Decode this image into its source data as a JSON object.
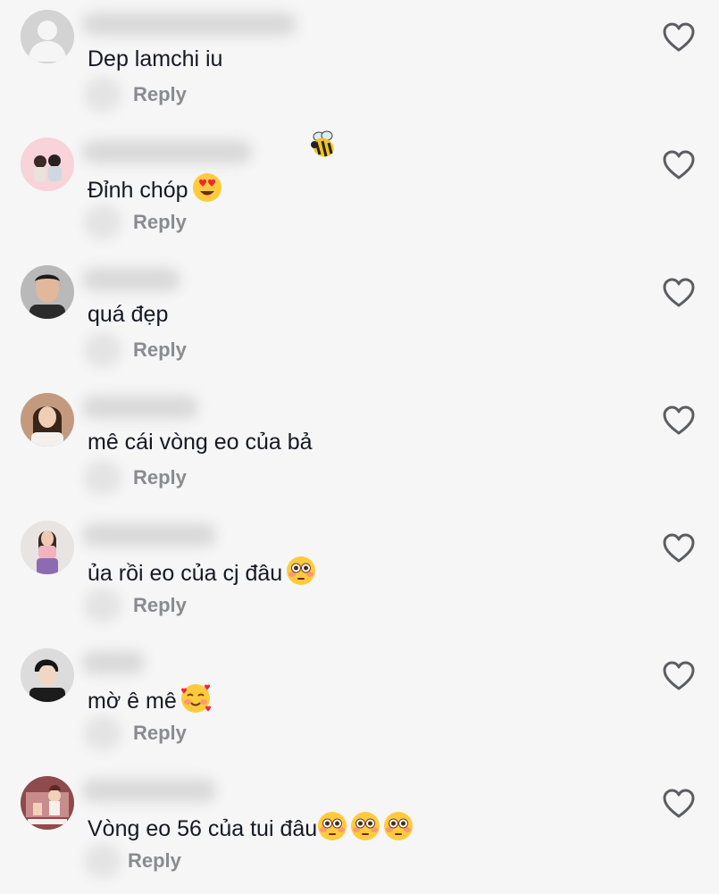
{
  "comments": [
    {
      "text": "Dep lamchi iu",
      "emoji": [],
      "reply_label": "Reply",
      "avatar": "default-avatar",
      "username_width": 240
    },
    {
      "text": "Đỉnh chóp",
      "emoji": [
        "heart-eyes-emoji"
      ],
      "reply_label": "Reply",
      "avatar": "couple-photo-avatar",
      "username_width": 190,
      "username_emoji": "bee-emoji"
    },
    {
      "text": "quá đẹp",
      "emoji": [],
      "reply_label": "Reply",
      "avatar": "man-photo-avatar",
      "username_width": 110
    },
    {
      "text": "mê cái vòng eo của bả",
      "emoji": [],
      "reply_label": "Reply",
      "avatar": "woman-photo-avatar",
      "username_width": 130
    },
    {
      "text": "ủa rồi eo của cj đâu",
      "emoji": [
        "flushed-emoji"
      ],
      "reply_label": "Reply",
      "avatar": "woman-pink-avatar",
      "username_width": 150
    },
    {
      "text": "mờ ê mê",
      "emoji": [
        "smiling-hearts-emoji"
      ],
      "reply_label": "Reply",
      "avatar": "man-dark-avatar",
      "username_width": 70
    },
    {
      "text": "Vòng eo 56 của tui đâu",
      "emoji": [
        "flushed-emoji",
        "flushed-emoji",
        "flushed-emoji"
      ],
      "reply_label": "Reply",
      "avatar": "cartoon-avatar",
      "username_width": 150
    }
  ],
  "colors": {
    "background": "#f6f6f6",
    "text": "#161823",
    "reply": "#8a8b91",
    "icon": "#5c5d63"
  },
  "icons": {
    "like": "heart-outline-icon"
  }
}
